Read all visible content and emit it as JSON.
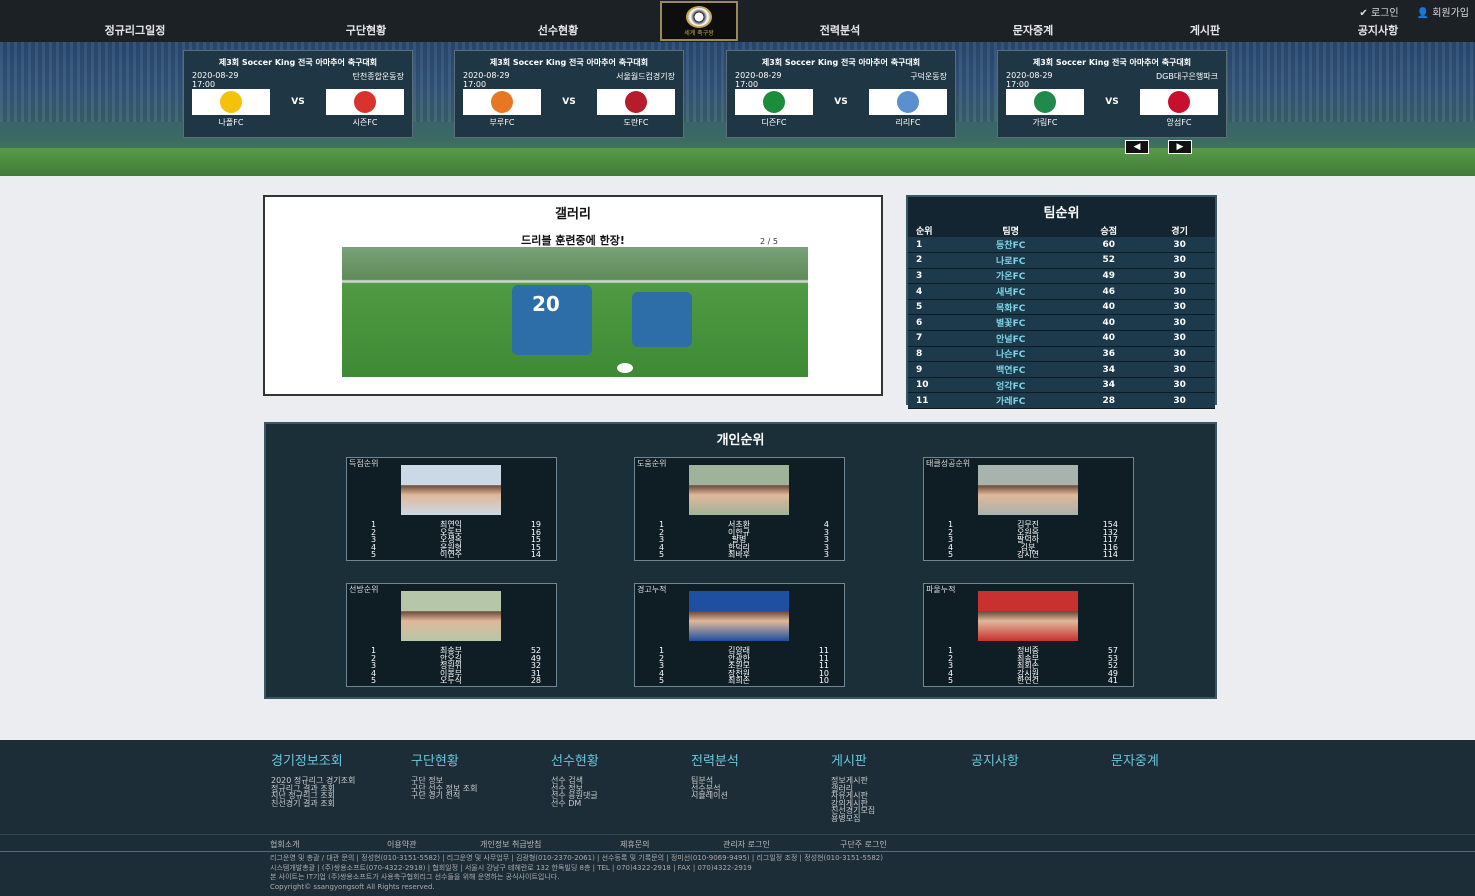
{
  "utility": {
    "login": "✔ 로그인",
    "join": "👤 회원가입"
  },
  "nav": [
    "정규리그일정",
    "구단현황",
    "선수현황",
    "전력분석",
    "문자중계",
    "게시판",
    "공지사항"
  ],
  "logo_text": "세계 축구왕",
  "matches": [
    {
      "title": "제3회 Soccer King 전국 아마추어 축구대회",
      "date": "2020-08-29",
      "time": "17:00",
      "venue": "탄천종합운동장",
      "home": "나폴FC",
      "away": "시즌FC",
      "vs": "VS",
      "home_color": "#f4c20d",
      "away_color": "#d9322f"
    },
    {
      "title": "제3회 Soccer King 전국 아마추어 축구대회",
      "date": "2020-08-29",
      "time": "17:00",
      "venue": "서울월드컵경기장",
      "home": "부루FC",
      "away": "도란FC",
      "vs": "VS",
      "home_color": "#e87722",
      "away_color": "#b71c2c"
    },
    {
      "title": "제3회 Soccer King 전국 아마추어 축구대회",
      "date": "2020-08-29",
      "time": "17:00",
      "venue": "구덕운동장",
      "home": "디즌FC",
      "away": "리리FC",
      "vs": "VS",
      "home_color": "#1b8c3a",
      "away_color": "#5a8fd0"
    },
    {
      "title": "제3회 Soccer King 전국 아마추어 축구대회",
      "date": "2020-08-29",
      "time": "17:00",
      "venue": "DGB대구은행파크",
      "home": "가림FC",
      "away": "앙섬FC",
      "vs": "VS",
      "home_color": "#1f8a4c",
      "away_color": "#c8102e"
    }
  ],
  "carousel": {
    "prev": "◀",
    "next": "▶"
  },
  "gallery": {
    "heading": "갤러리",
    "caption": "드리블 훈련중에 한장!",
    "counter": "2 / 5",
    "jersey": "20"
  },
  "team_rank": {
    "heading": "팀순위",
    "columns": [
      "순위",
      "팀명",
      "승점",
      "경기"
    ],
    "rows": [
      [
        "1",
        "등찬FC",
        "60",
        "30"
      ],
      [
        "2",
        "나로FC",
        "52",
        "30"
      ],
      [
        "3",
        "가온FC",
        "49",
        "30"
      ],
      [
        "4",
        "새녁FC",
        "46",
        "30"
      ],
      [
        "5",
        "목화FC",
        "40",
        "30"
      ],
      [
        "6",
        "별꽃FC",
        "40",
        "30"
      ],
      [
        "7",
        "안널FC",
        "40",
        "30"
      ],
      [
        "8",
        "나슨FC",
        "36",
        "30"
      ],
      [
        "9",
        "백연FC",
        "34",
        "30"
      ],
      [
        "10",
        "엉각FC",
        "34",
        "30"
      ],
      [
        "11",
        "가레FC",
        "28",
        "30"
      ]
    ]
  },
  "individual": {
    "heading": "개인순위",
    "cards": [
      {
        "title": "득점순위",
        "rows": [
          [
            "1",
            "최연익",
            "19"
          ],
          [
            "2",
            "오동부",
            "16"
          ],
          [
            "3",
            "오생옥",
            "15"
          ],
          [
            "4",
            "윤원형",
            "15"
          ],
          [
            "5",
            "이연주",
            "14"
          ]
        ]
      },
      {
        "title": "도움순위",
        "rows": [
          [
            "1",
            "서초환",
            "4"
          ],
          [
            "2",
            "이한규",
            "3"
          ],
          [
            "3",
            "팔병",
            "3"
          ],
          [
            "4",
            "한덕리",
            "3"
          ],
          [
            "5",
            "최바후",
            "3"
          ]
        ]
      },
      {
        "title": "태클성공순위",
        "rows": [
          [
            "1",
            "김무진",
            "154"
          ],
          [
            "2",
            "오원옥",
            "132"
          ],
          [
            "3",
            "팔덕하",
            "117"
          ],
          [
            "4",
            "김분",
            "116"
          ],
          [
            "5",
            "강시연",
            "114"
          ]
        ]
      },
      {
        "title": "선방순위",
        "rows": [
          [
            "1",
            "최송부",
            "52"
          ],
          [
            "2",
            "안오길",
            "49"
          ],
          [
            "3",
            "정원위",
            "32"
          ],
          [
            "4",
            "이봉부",
            "31"
          ],
          [
            "5",
            "오두식",
            "28"
          ]
        ]
      },
      {
        "title": "경고누적",
        "rows": [
          [
            "1",
            "김양래",
            "11"
          ],
          [
            "2",
            "안광한",
            "11"
          ],
          [
            "3",
            "조원모",
            "11"
          ],
          [
            "4",
            "장천원",
            "10"
          ],
          [
            "5",
            "최희손",
            "10"
          ]
        ]
      },
      {
        "title": "파울누적",
        "rows": [
          [
            "1",
            "정비중",
            "57"
          ],
          [
            "2",
            "최송부",
            "53"
          ],
          [
            "3",
            "최회손",
            "52"
          ],
          [
            "4",
            "강시원",
            "49"
          ],
          [
            "5",
            "한연건",
            "41"
          ]
        ]
      }
    ]
  },
  "footer": {
    "columns": [
      {
        "title": "경기정보조회",
        "items": [
          "2020 정규리그 경기조회",
          "정규리그 결과 조회",
          "지난 정규리그 조회",
          "친선경기 결과 조회"
        ]
      },
      {
        "title": "구단현황",
        "items": [
          "구단 정보",
          "구단 선수 정보 조회",
          "구단 경기 전적"
        ]
      },
      {
        "title": "선수현황",
        "items": [
          "선수 검색",
          "선수 정보",
          "선수 응원댓글",
          "선수 DM"
        ]
      },
      {
        "title": "전력분석",
        "items": [
          "팀분석",
          "선수분석",
          "시뮬레이션"
        ]
      },
      {
        "title": "게시판",
        "items": [
          "정보게시판",
          "갤러리",
          "자유게시판",
          "강의게시판",
          "친선경기모집",
          "용병모집"
        ]
      },
      {
        "title": "공지사항",
        "items": []
      },
      {
        "title": "문자중계",
        "items": []
      }
    ],
    "links": [
      "협회소개",
      "이용약관",
      "개인정보 취급방침",
      "제휴문의",
      "관리자 로그인",
      "구단주 로그인"
    ],
    "info": [
      "리그운영 및 총괄 / 대관 문의 | 정성현(010-3151-5582) | 리그운영 및 사무업무 | 김광형(010-2370-2061) | 선수등록 및 기록문의 | 정미선(010-9069-9495) | 리그일정 조정 | 정성현(010-3151-5582)",
      "시스템개발총괄 | (주)쌍용소프트(070-4322-2918) | 협회일정 | 서울시 강남구 테헤란로 132 한독빌딩 8층 | TEL | 070)4322-2918 | FAX | 070)4322-2919",
      "본 사이트는 IT기업 (주)쌍용소프트가 사용축구협회리그 선수들을 위해 운영하는 공식사이트입니다.",
      "Copyright© ssangyongsoft All Rights reserved."
    ]
  }
}
